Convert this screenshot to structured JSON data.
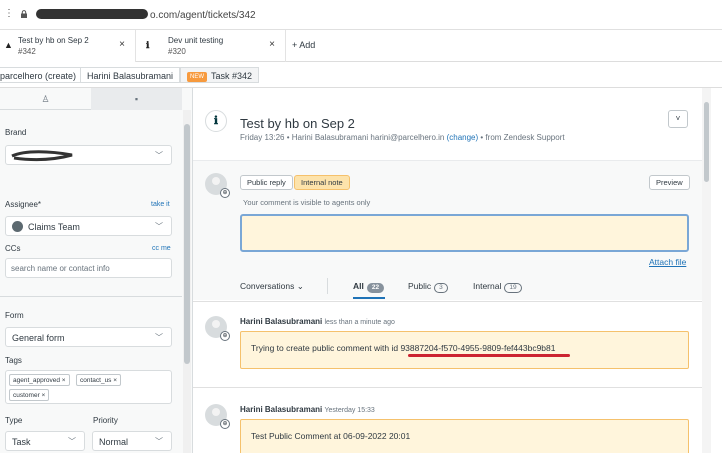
{
  "browser": {
    "url_suffix": "o.com/agent/tickets/342"
  },
  "tabs": [
    {
      "title": "Test by hb on Sep 2",
      "sub": "#342",
      "close": "×"
    },
    {
      "title": "Dev unit testing",
      "sub": "#320",
      "close": "×"
    }
  ],
  "add_tab": "+ Add",
  "breadcrumbs": {
    "org": "parcelhero (create)",
    "user": "Harini Balasubramani",
    "badge": "NEW",
    "task": "Task #342"
  },
  "sidebar": {
    "brand_label": "Brand",
    "assignee_label": "Assignee*",
    "take_it": "take it",
    "assignee_value": "Claims Team",
    "ccs_label": "CCs",
    "cc_me": "cc me",
    "ccs_placeholder": "search name or contact info",
    "form_label": "Form",
    "form_value": "General form",
    "tags_label": "Tags",
    "tags": [
      "agent_approved ×",
      "contact_us ×",
      "customer ×"
    ],
    "type_label": "Type",
    "priority_label": "Priority",
    "type_value": "Task",
    "priority_value": "Normal"
  },
  "ticket": {
    "title": "Test by hb on Sep 2",
    "meta_prefix": "Friday 13:26 • Harini Balasubramani  harini@parcelhero.in",
    "meta_change": "(change)",
    "meta_suffix": "• from Zendesk Support"
  },
  "composer": {
    "public_reply": "Public reply",
    "internal_note": "Internal note",
    "preview": "Preview",
    "hint": "Your comment is visible to agents only",
    "attach": "Attach file"
  },
  "filters": {
    "conversations": "Conversations",
    "all": "All",
    "all_count": "22",
    "public": "Public",
    "public_count": "3",
    "internal": "Internal",
    "internal_count": "19"
  },
  "events": [
    {
      "author": "Harini Balasubramani",
      "time": "less than a minute ago",
      "text": "Trying to create public comment with id",
      "id": "93887204-f570-4955-9809-fef443bc9b81"
    },
    {
      "author": "Harini Balasubramani",
      "time": "Yesterday 15:33",
      "text": "Test Public Comment at 06-09-2022 20:01",
      "id": ""
    }
  ]
}
